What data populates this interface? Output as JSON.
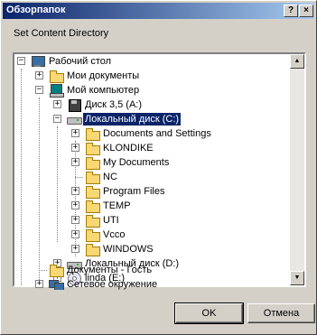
{
  "window": {
    "title": "Обзорпапок",
    "help_label": "?",
    "close_label": "×"
  },
  "instruction": "Set Content Directory",
  "tree": {
    "items": [
      {
        "label": "Рабочий стол",
        "toggle": "−"
      },
      {
        "label": "Мои документы",
        "toggle": "+"
      },
      {
        "label": "Мой компьютер",
        "toggle": "−"
      },
      {
        "label": "Диск 3,5 (A:)",
        "toggle": "+"
      },
      {
        "label": "Локальный диск (C:)",
        "toggle": "−"
      },
      {
        "label": "Documents and Settings",
        "toggle": "+"
      },
      {
        "label": "KLONDIKE",
        "toggle": "+"
      },
      {
        "label": "My Documents",
        "toggle": "+"
      },
      {
        "label": "NC",
        "toggle": ""
      },
      {
        "label": "Program Files",
        "toggle": "+"
      },
      {
        "label": "TEMP",
        "toggle": "+"
      },
      {
        "label": "UTI",
        "toggle": "+"
      },
      {
        "label": "Vcco",
        "toggle": "+"
      },
      {
        "label": "WINDOWS",
        "toggle": "+"
      },
      {
        "label": "Локальный диск (D:)",
        "toggle": "+"
      },
      {
        "label": "linda (E:)",
        "toggle": "+"
      },
      {
        "label": "Документы - Гость",
        "toggle": ""
      },
      {
        "label": "Сетевое окружение",
        "toggle": "+"
      }
    ]
  },
  "scrollbar": {
    "up_arrow": "▲",
    "down_arrow": "▼"
  },
  "buttons": {
    "ok": "OK",
    "cancel": "Отмена"
  },
  "colors": {
    "selection": "#0a246a",
    "face": "#d4d0c8"
  }
}
